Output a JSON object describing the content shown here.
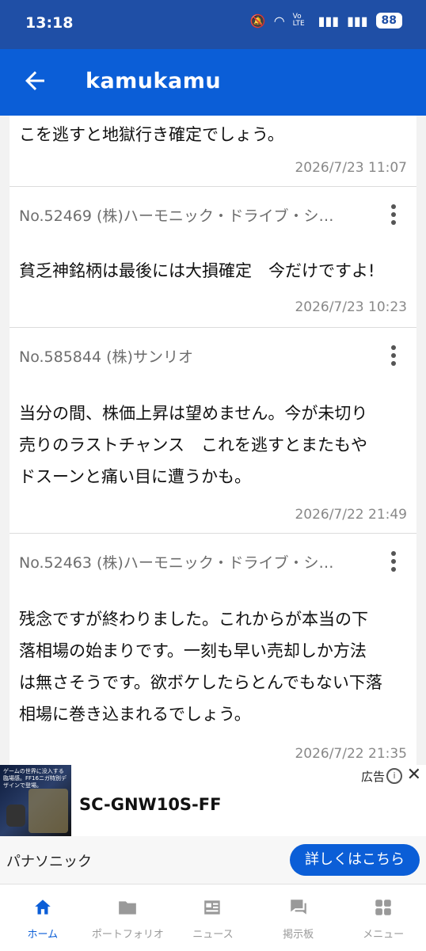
{
  "status_bar": {
    "time": "13:18",
    "network": "Vo LTE",
    "battery": "88"
  },
  "app_bar": {
    "title": "kamukamu"
  },
  "posts": [
    {
      "body_lines": [
        "こを逃すと地獄行き確定でしょう。"
      ],
      "date": "2026/7/23 11:07"
    },
    {
      "header": "No.52469 (株)ハーモニック・ドライブ・シ…",
      "body_lines": [
        "貧乏神銘柄は最後には大損確定　今だけですよ!"
      ],
      "date": "2026/7/23 10:23"
    },
    {
      "header": "No.585844 (株)サンリオ",
      "body_lines": [
        "当分の間、株価上昇は望めません。今が未切り",
        "売りのラストチャンス　これを逃すとまたもや",
        "ドスーンと痛い目に遭うかも。"
      ],
      "date": "2026/7/22 21:49"
    },
    {
      "header": "No.52463 (株)ハーモニック・ドライブ・シ…",
      "body_lines": [
        "残念ですが終わりました。これからが本当の下",
        "落相場の始まりです。一刻も早い売却しか方法",
        "は無さそうです。欲ボケしたらとんでもない下落",
        "相場に巻き込まれるでしょう。"
      ],
      "date": "2026/7/22 21:35"
    }
  ],
  "ad": {
    "image_text": "ゲームの世界に没入する臨場感。FF16ニガ特別デザインで登場。",
    "title": "SC-GNW10S-FF",
    "label": "広告",
    "advertiser": "パナソニック",
    "cta": "詳しくはこちら"
  },
  "bottom_nav": [
    {
      "label": "ホーム",
      "icon": "home-icon",
      "active": true
    },
    {
      "label": "ポートフォリオ",
      "icon": "folder-icon",
      "active": false
    },
    {
      "label": "ニュース",
      "icon": "news-icon",
      "active": false
    },
    {
      "label": "掲示板",
      "icon": "chat-icon",
      "active": false
    },
    {
      "label": "メニュー",
      "icon": "grid-icon",
      "active": false
    }
  ],
  "colors": {
    "primary": "#0b5ed7",
    "status_bar": "#1f4fa6",
    "inactive": "#999999"
  }
}
